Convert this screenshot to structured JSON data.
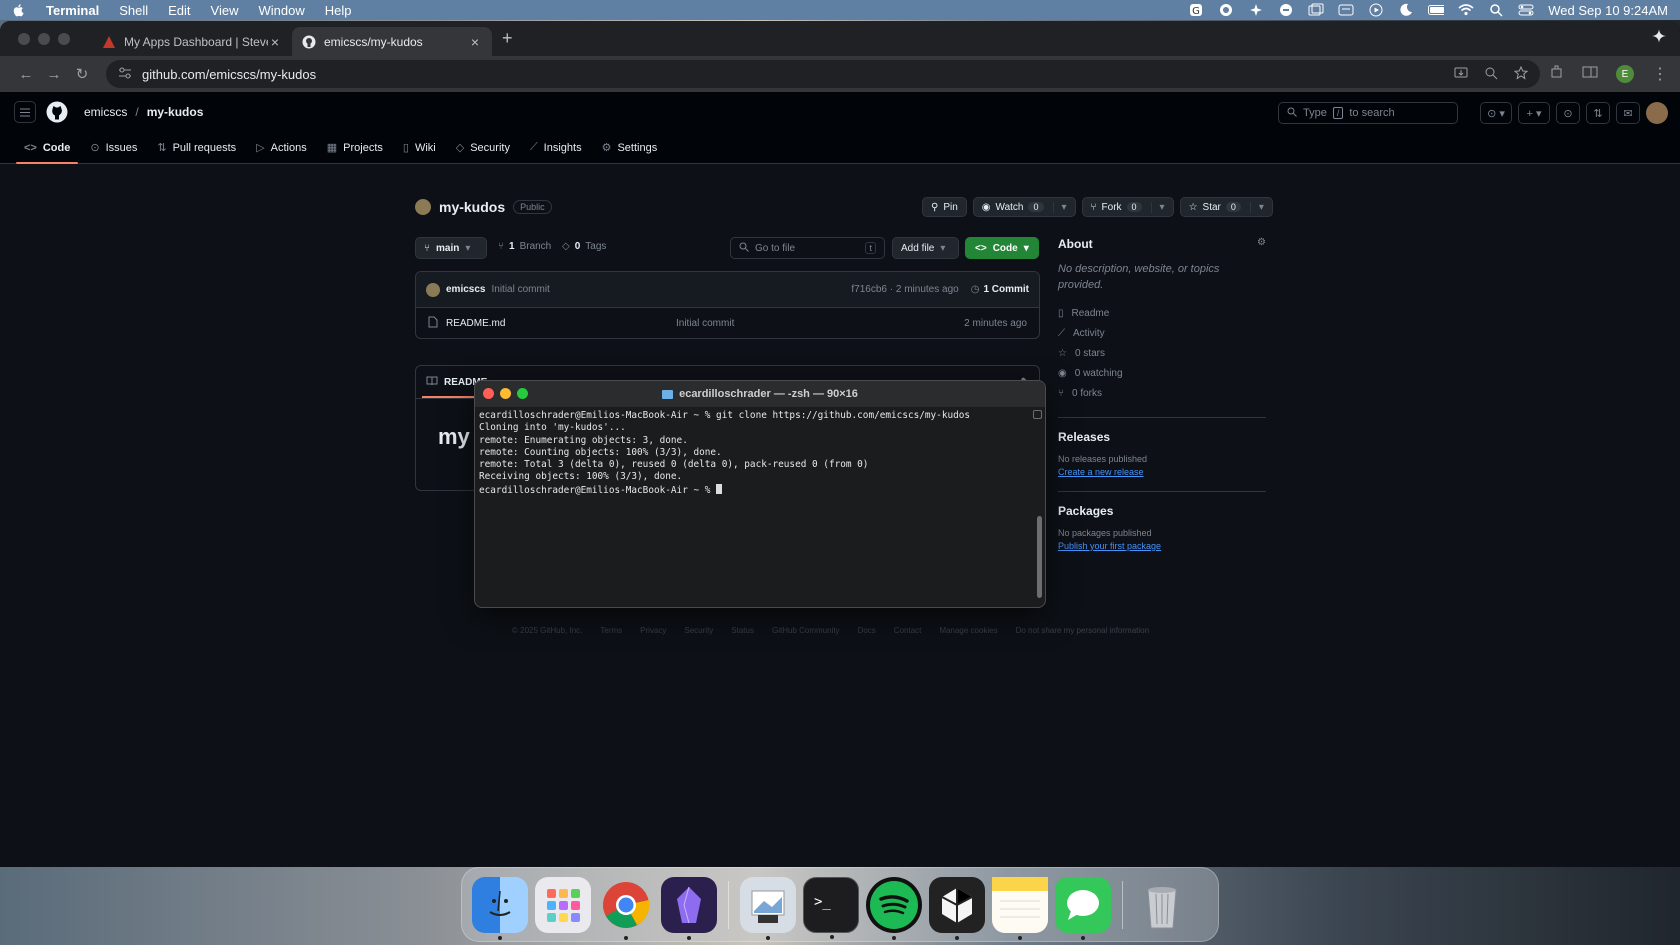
{
  "menubar": {
    "app": "Terminal",
    "items": [
      "Shell",
      "Edit",
      "View",
      "Window",
      "Help"
    ],
    "datetime": "Wed Sep 10  9:24AM"
  },
  "browser": {
    "tabs": [
      {
        "title": "My Apps Dashboard | Steven",
        "active": false
      },
      {
        "title": "emicscs/my-kudos",
        "active": true
      }
    ],
    "new_tab": "+",
    "url": "github.com/emicscs/my-kudos",
    "profile_initial": "E"
  },
  "github": {
    "owner": "emicscs",
    "separator": "/",
    "repo": "my-kudos",
    "search_placeholder_pre": "Type",
    "search_key": "/",
    "search_placeholder_post": "to search",
    "nav": [
      {
        "label": "Code",
        "icon": "code-icon",
        "active": true
      },
      {
        "label": "Issues",
        "icon": "issue-icon"
      },
      {
        "label": "Pull requests",
        "icon": "pull-request-icon"
      },
      {
        "label": "Actions",
        "icon": "play-icon"
      },
      {
        "label": "Projects",
        "icon": "table-icon"
      },
      {
        "label": "Wiki",
        "icon": "book-icon"
      },
      {
        "label": "Security",
        "icon": "shield-icon"
      },
      {
        "label": "Insights",
        "icon": "graph-icon"
      },
      {
        "label": "Settings",
        "icon": "gear-icon"
      }
    ],
    "visibility": "Public",
    "pin": "Pin",
    "watch": {
      "label": "Watch",
      "count": "0"
    },
    "fork": {
      "label": "Fork",
      "count": "0"
    },
    "star": {
      "label": "Star",
      "count": "0"
    },
    "branch": "main",
    "branches_count": "1",
    "branches_label": "Branch",
    "tags_count": "0",
    "tags_label": "Tags",
    "go_to_file": "Go to file",
    "go_to_file_key": "t",
    "add_file": "Add file",
    "code_button": "Code",
    "commit": {
      "author": "emicscs",
      "message": "Initial commit",
      "hash_time": "f716cb6 · 2 minutes ago",
      "count": "1 Commit"
    },
    "files": [
      {
        "name": "README.md",
        "message": "Initial commit",
        "time": "2 minutes ago"
      }
    ],
    "readme_tab": "README",
    "readme_title": "my",
    "about": {
      "title": "About",
      "description": "No description, website, or topics provided.",
      "stats": [
        {
          "label": "Readme",
          "icon": "book-icon"
        },
        {
          "label": "Activity",
          "icon": "pulse-icon"
        },
        {
          "label": "0 stars",
          "icon": "star-icon"
        },
        {
          "label": "0 watching",
          "icon": "eye-icon"
        },
        {
          "label": "0 forks",
          "icon": "fork-icon"
        }
      ],
      "releases_title": "Releases",
      "releases_none": "No releases published",
      "releases_link": "Create a new release",
      "packages_title": "Packages",
      "packages_none": "No packages published",
      "packages_link": "Publish your first package"
    },
    "footer": [
      "© 2025 GitHub, Inc.",
      "Terms",
      "Privacy",
      "Security",
      "Status",
      "GitHub Community",
      "Docs",
      "Contact",
      "Manage cookies",
      "Do not share my personal information"
    ]
  },
  "terminal": {
    "title": "ecardilloschrader — -zsh — 90×16",
    "lines": [
      "ecardilloschrader@Emilios-MacBook-Air ~ % git clone https://github.com/emicscs/my-kudos",
      "Cloning into 'my-kudos'...",
      "remote: Enumerating objects: 3, done.",
      "remote: Counting objects: 100% (3/3), done.",
      "remote: Total 3 (delta 0), reused 0 (delta 0), pack-reused 0 (from 0)",
      "Receiving objects: 100% (3/3), done."
    ],
    "prompt": "ecardilloschrader@Emilios-MacBook-Air ~ % "
  },
  "dock": {
    "apps": [
      {
        "name": "Finder",
        "icon": "finder-icon",
        "color": "#3d8ee8"
      },
      {
        "name": "Launchpad",
        "icon": "launchpad-icon",
        "color": "#e9e9ee"
      },
      {
        "name": "Google Chrome",
        "icon": "chrome-icon",
        "color": "#ffffff"
      },
      {
        "name": "Obsidian",
        "icon": "obsidian-icon",
        "color": "#3b2a6b"
      },
      {
        "name": "Preview",
        "icon": "preview-icon",
        "color": "#d7dde4"
      },
      {
        "name": "Terminal",
        "icon": "terminal-icon",
        "color": "#1d1d1f"
      },
      {
        "name": "Spotify",
        "icon": "spotify-icon",
        "color": "#1db954"
      },
      {
        "name": "Unity",
        "icon": "unity-icon",
        "color": "#222222"
      },
      {
        "name": "Notes",
        "icon": "notes-icon",
        "color": "#fbe27a"
      },
      {
        "name": "Messages",
        "icon": "messages-icon",
        "color": "#34c759"
      },
      {
        "name": "Trash",
        "icon": "trash-icon",
        "color": "#b8bcc2"
      }
    ]
  }
}
